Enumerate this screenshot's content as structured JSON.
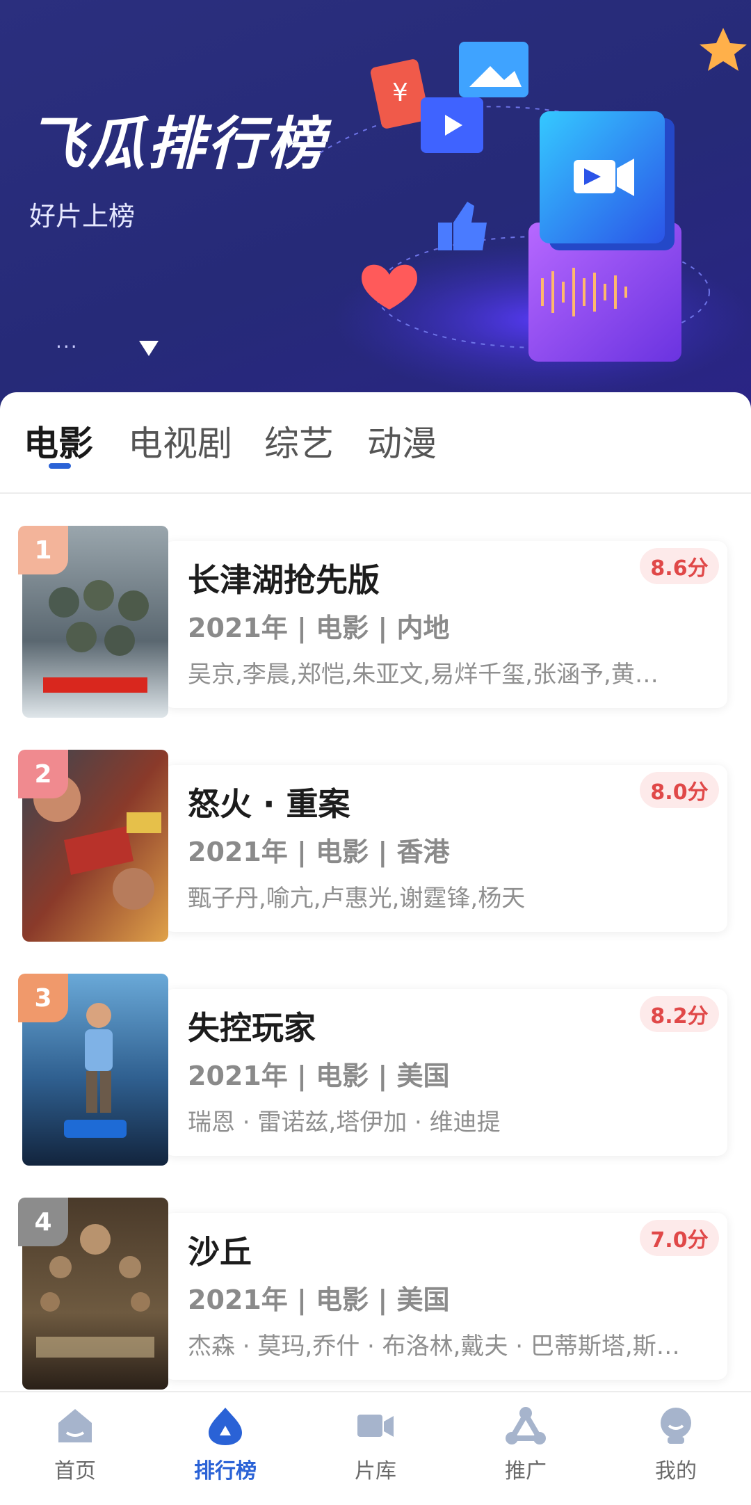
{
  "header": {
    "title": "飞瓜排行榜",
    "subtitle": "好片上榜",
    "menu_dots": "···"
  },
  "tabs": [
    {
      "label": "电影",
      "active": true
    },
    {
      "label": "电视剧",
      "active": false
    },
    {
      "label": "综艺",
      "active": false
    },
    {
      "label": "动漫",
      "active": false
    }
  ],
  "movies": [
    {
      "rank": "1",
      "title": "长津湖抢先版",
      "meta": "2021年 | 电影 | 内地",
      "cast": "吴京,李晨,郑恺,朱亚文,易烊千玺,张涵予,黄…",
      "score": "8.6分",
      "rank_color": "#f3b49a"
    },
    {
      "rank": "2",
      "title": "怒火 · 重案",
      "meta": "2021年 | 电影 |  香港",
      "cast": "甄子丹,喻亢,卢惠光,谢霆锋,杨天",
      "score": "8.0分",
      "rank_color": "#f08a8f"
    },
    {
      "rank": "3",
      "title": "失控玩家",
      "meta": "2021年 | 电影 |  美国",
      "cast": "瑞恩 · 雷诺兹,塔伊加 · 维迪提",
      "score": "8.2分",
      "rank_color": "#f0996b"
    },
    {
      "rank": "4",
      "title": "沙丘",
      "meta": "2021年 | 电影 | 美国",
      "cast": "杰森 · 莫玛,乔什 · 布洛林,戴夫 · 巴蒂斯塔,斯…",
      "score": "7.0分",
      "rank_color": "#8c8c8c"
    }
  ],
  "bottom_nav": [
    {
      "label": "首页",
      "icon": "home-icon",
      "active": false
    },
    {
      "label": "排行榜",
      "icon": "ranking-icon",
      "active": true
    },
    {
      "label": "片库",
      "icon": "video-camera-icon",
      "active": false
    },
    {
      "label": "推广",
      "icon": "share-icon",
      "active": false
    },
    {
      "label": "我的",
      "icon": "user-icon",
      "active": false
    }
  ],
  "colors": {
    "accent": "#2a62d6",
    "score_text": "#e04848",
    "score_bg": "#fdeaea",
    "header_bg": "#282c7c"
  }
}
